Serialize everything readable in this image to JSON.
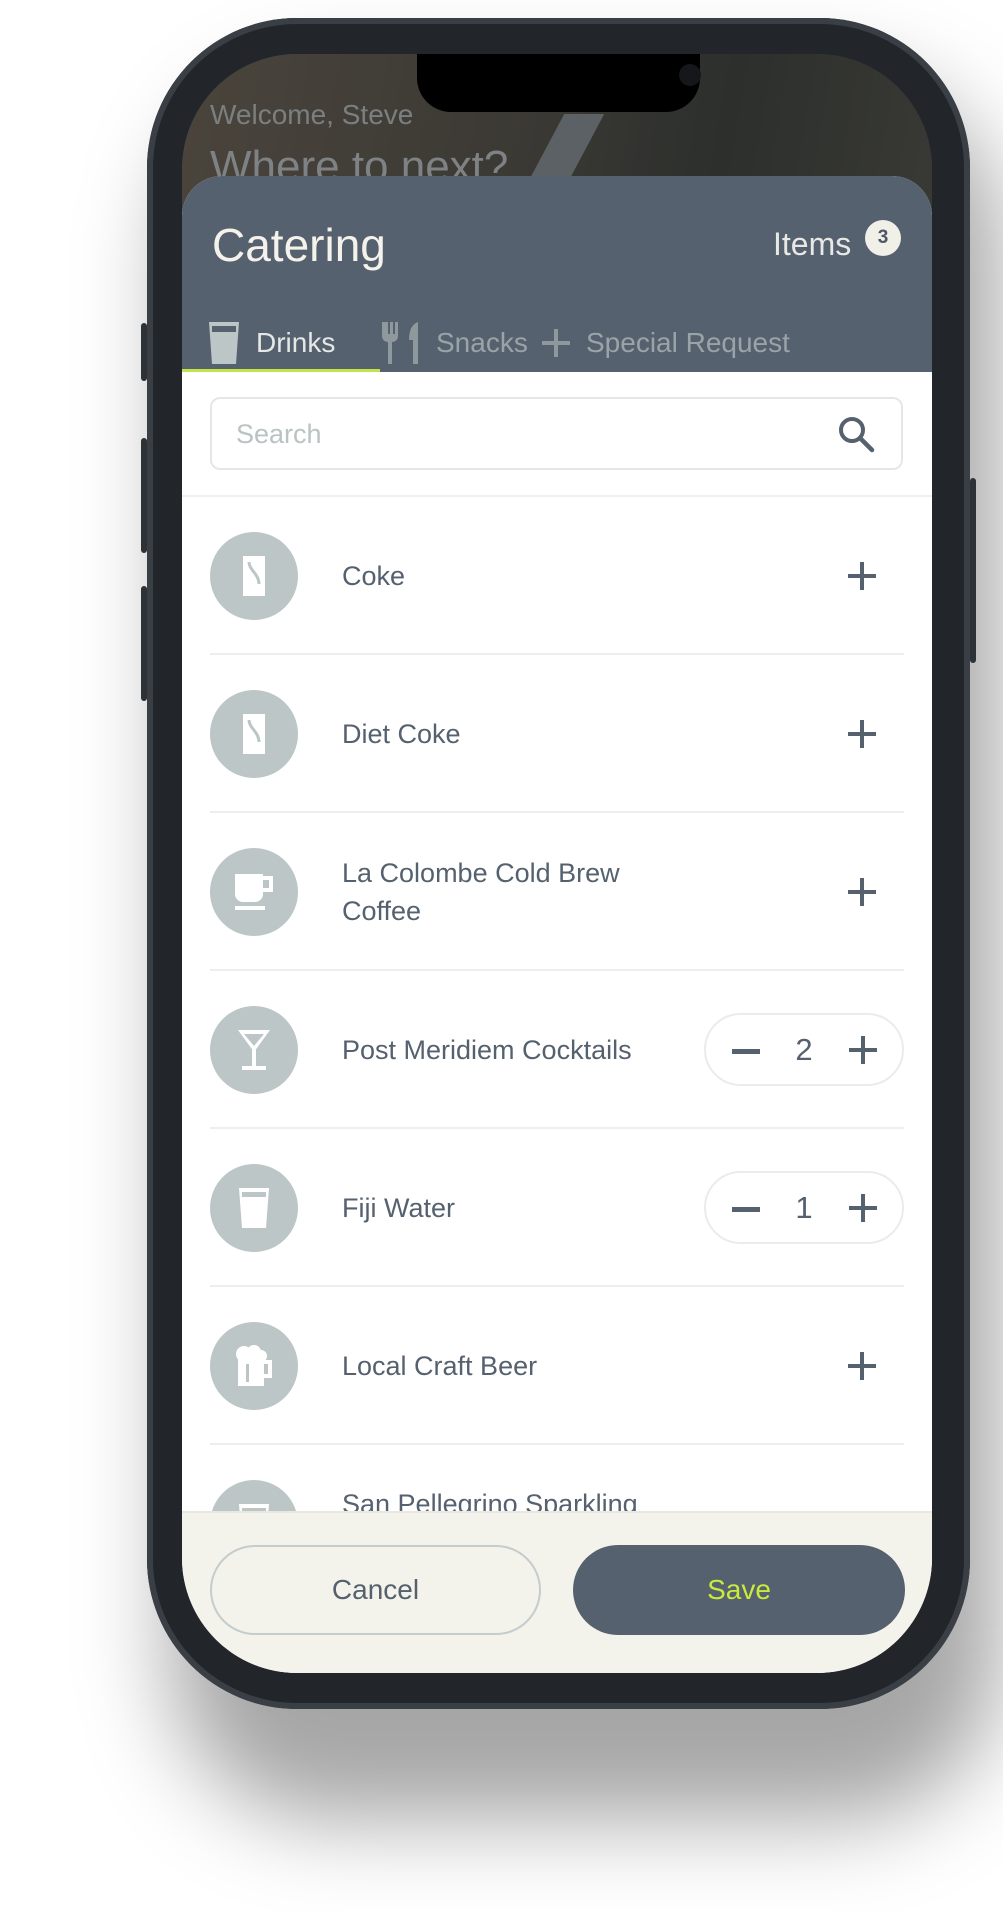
{
  "background": {
    "welcome": "Welcome, Steve",
    "headline": "Where to next?"
  },
  "header": {
    "title": "Catering",
    "items_label": "Items",
    "items_count": "3"
  },
  "tabs": [
    {
      "label": "Drinks",
      "icon": "glass-icon",
      "active": true
    },
    {
      "label": "Snacks",
      "icon": "fork-knife-icon",
      "active": false
    },
    {
      "label": "Special Request",
      "icon": "plus-icon",
      "active": false
    }
  ],
  "search": {
    "placeholder": "Search",
    "value": ""
  },
  "items": [
    {
      "name": "Coke",
      "icon": "can-icon",
      "quantity": null
    },
    {
      "name": "Diet Coke",
      "icon": "can-icon",
      "quantity": null
    },
    {
      "name": "La Colombe Cold Brew Coffee",
      "icon": "coffee-cup-icon",
      "quantity": null
    },
    {
      "name": "Post Meridiem Cocktails",
      "icon": "cocktail-icon",
      "quantity": "2"
    },
    {
      "name": "Fiji Water",
      "icon": "glass-icon",
      "quantity": "1"
    },
    {
      "name": "Local Craft Beer",
      "icon": "beer-mug-icon",
      "quantity": null
    },
    {
      "name": "San Pellegrino Sparkling",
      "icon": "glass-icon",
      "quantity": null
    }
  ],
  "footer": {
    "cancel_label": "Cancel",
    "save_label": "Save"
  },
  "colors": {
    "header": "#55616e",
    "accent": "#c4e34a",
    "icon_bg": "#bcc6c6",
    "footer": "#f3f3ec"
  }
}
